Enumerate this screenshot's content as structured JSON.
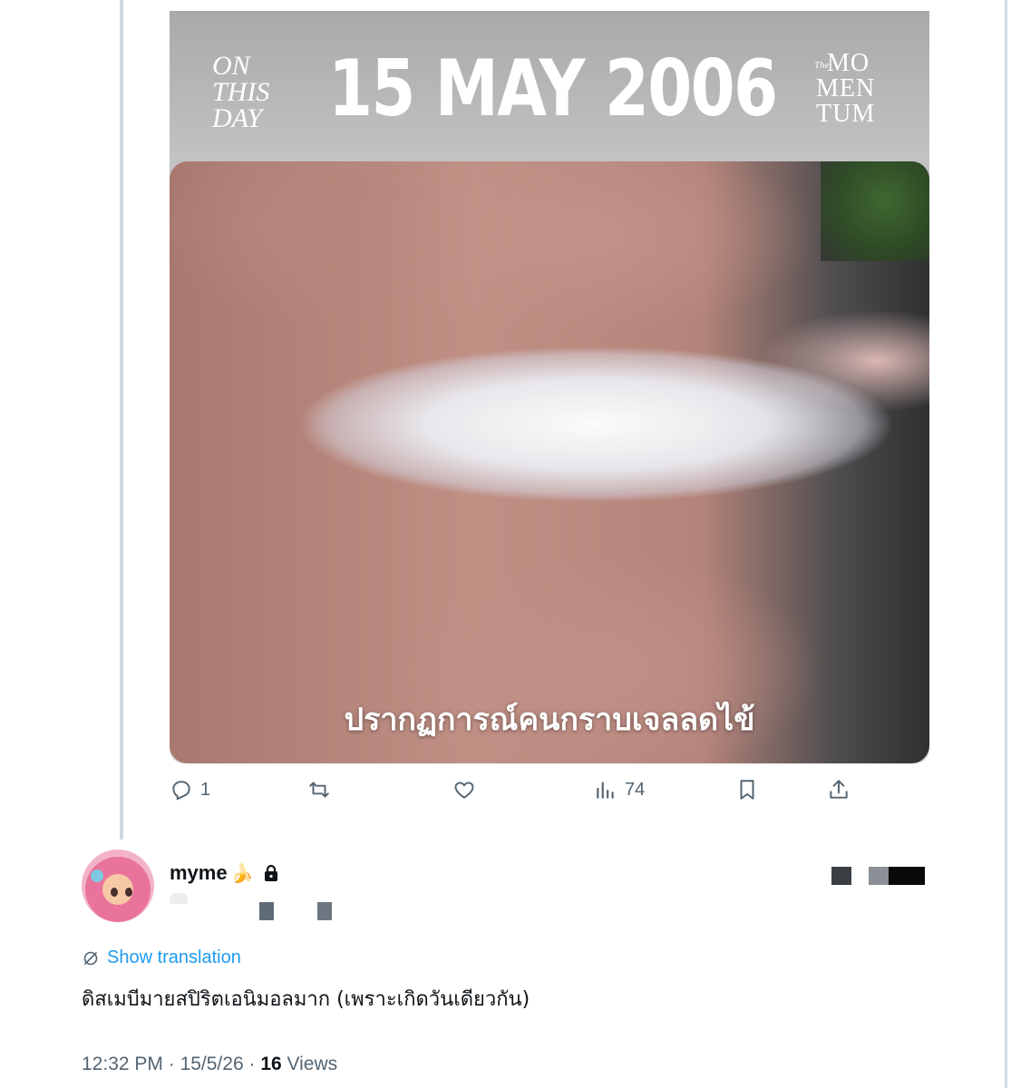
{
  "card": {
    "on_this_day": [
      "ON",
      "THIS",
      "DAY"
    ],
    "date": "15 MAY 2006",
    "logo_prefix": "The",
    "logo_lines": [
      "MO",
      "MEN",
      "TUM"
    ],
    "caption": "ปรากฏการณ์คนกราบเจลลดไข้"
  },
  "actions": {
    "reply_count": "1",
    "views_count": "74"
  },
  "reply": {
    "username": "myme",
    "username_emoji": "🍌",
    "translate_label": "Show translation",
    "text": "ดิสเมบีมายสปิริตเอนิมอลมาก (เพราะเกิดวันเดียวกัน)",
    "time": "12:32 PM",
    "date": "15/5/26",
    "views": "16",
    "views_label": "Views"
  },
  "colors": {
    "accent": "#1d9bf0",
    "secondary_text": "#536471",
    "thread_line": "#cfd9de"
  }
}
